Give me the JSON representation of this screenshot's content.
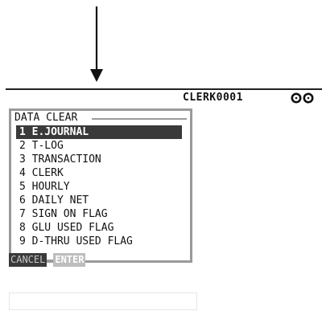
{
  "status_bar": {
    "clerk": "CLERK0001"
  },
  "panel": {
    "title": "DATA CLEAR",
    "items": [
      {
        "num": "1",
        "label": "E.JOURNAL",
        "selected": true
      },
      {
        "num": "2",
        "label": "T-LOG"
      },
      {
        "num": "3",
        "label": "TRANSACTION"
      },
      {
        "num": "4",
        "label": "CLERK"
      },
      {
        "num": "5",
        "label": "HOURLY"
      },
      {
        "num": "6",
        "label": "DAILY NET"
      },
      {
        "num": "7",
        "label": "SIGN ON FLAG"
      },
      {
        "num": "8",
        "label": "GLU USED FLAG"
      },
      {
        "num": "9",
        "label": "D-THRU USED FLAG"
      }
    ]
  },
  "softkeys": {
    "cancel": "CANCEL",
    "enter": "ENTER"
  },
  "icons": [
    "down-arrow-icon",
    "ring-icon",
    "ring-icon"
  ],
  "colors": {
    "selection": "#3a3a3a",
    "frame": "#9a9a9a",
    "enter_key": "#bdbdbd"
  }
}
